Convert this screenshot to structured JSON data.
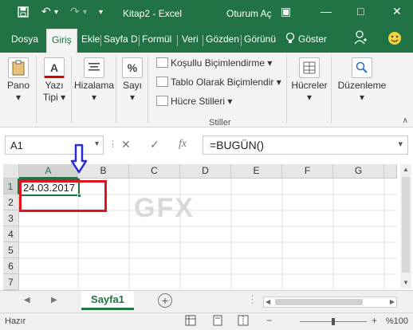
{
  "titlebar": {
    "doc_title": "Kitap2  -  Excel",
    "signin": "Oturum Aç",
    "save_icon": "⬛",
    "undo_icon": "↶",
    "redo_icon": "↷",
    "customize_icon": "▾",
    "ribbon_options_icon": "▣",
    "minimize_icon": "—",
    "restore_icon": "□",
    "close_icon": "✕",
    "accent": "#217346"
  },
  "tabs": {
    "items": [
      "Dosya",
      "Giriş",
      "Ekle",
      "Sayfa D",
      "Formül",
      "Veri",
      "Gözden",
      "Görünü"
    ],
    "active": "Giriş",
    "tell_me": "Göster",
    "tell_me_icon": "☉",
    "account_icon": "☺",
    "smiley_icon": "☺"
  },
  "ribbon": {
    "pano": "Pano",
    "yazi_tipi_1": "Yazı",
    "yazi_tipi_2": "Tipi",
    "hizalama": "Hizalama",
    "sayi": "Sayı",
    "kosullu": "Koşullu Biçimlendirme",
    "tablo": "Tablo Olarak Biçimlendir",
    "hucre_stilleri": "Hücre Stilleri",
    "stiller": "Stiller",
    "hucreler": "Hücreler",
    "duzenleme": "Düzenleme",
    "dropdown": "▾"
  },
  "formula_bar": {
    "name_box": "A1",
    "formula": "=BUGÜN()",
    "cancel_icon": "✕",
    "enter_icon": "✓",
    "fx_label": "fx",
    "sep": "⋮"
  },
  "grid": {
    "columns": [
      "A",
      "B",
      "C",
      "D",
      "E",
      "F",
      "G"
    ],
    "rows": [
      "1",
      "2",
      "3",
      "4",
      "5",
      "6",
      "7"
    ],
    "active_cell_value": "24.03.2017",
    "watermark": "GFX"
  },
  "sheets": {
    "tabs": [
      "Sayfa1"
    ],
    "add_icon": "⊕",
    "nav_prev": "◀",
    "nav_next": "▶"
  },
  "status": {
    "ready": "Hazır",
    "zoom": "%100",
    "minus": "−",
    "plus": "+"
  }
}
